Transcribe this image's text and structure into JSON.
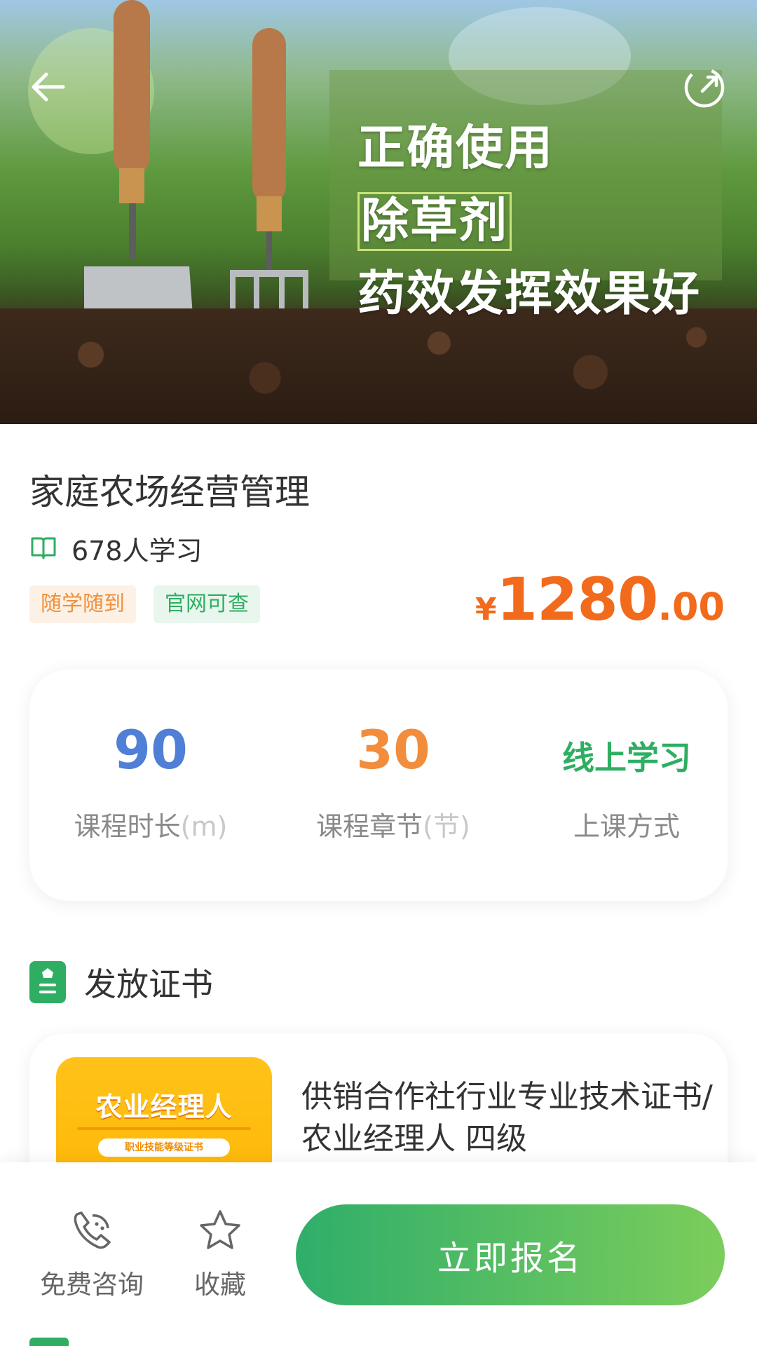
{
  "hero": {
    "headline_part1": "正确使用",
    "headline_highlight": "除草剂",
    "headline_line2": "药效发挥效果好"
  },
  "nav": {
    "back_icon": "arrow-left-icon",
    "share_icon": "share-icon"
  },
  "course": {
    "title": "家庭农场经营管理",
    "learners": "678人学习",
    "tags": [
      "随学随到",
      "官网可查"
    ],
    "price_symbol": "¥",
    "price_integer": "1280",
    "price_decimal": ".00"
  },
  "stats": {
    "duration_value": "90",
    "duration_label": "课程时长",
    "duration_unit": "(m)",
    "chapters_value": "30",
    "chapters_label": "课程章节",
    "chapters_unit": "(节)",
    "mode_value": "线上学习",
    "mode_label": "上课方式"
  },
  "certificate": {
    "section_title": "发放证书",
    "thumb_title": "农业经理人",
    "thumb_subtitle": "职业技能等级证书",
    "name": "供销合作社行业专业技术证书/农业经理人 四级"
  },
  "bottom_bar": {
    "consult_label": "免费咨询",
    "favorite_label": "收藏",
    "enroll_label": "立即报名"
  },
  "colors": {
    "accent_green": "#2fae63",
    "price_orange": "#f26a1b",
    "duration_blue": "#4f7fd6",
    "chapters_orange": "#f18d3c"
  }
}
